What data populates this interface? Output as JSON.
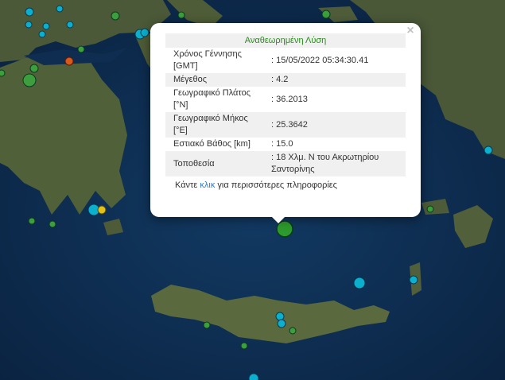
{
  "popup": {
    "title": "Αναθεωρημένη Λύση",
    "close_icon": "×",
    "rows": [
      {
        "label": "Χρόνος Γέννησης [GMT]",
        "value": ": 15/05/2022 05:34:30.41"
      },
      {
        "label": "Μέγεθος",
        "value": ": 4.2"
      },
      {
        "label": "Γεωγραφικό Πλάτος [°N]",
        "value": ": 36.2013"
      },
      {
        "label": "Γεωγραφικό Μήκος [°E]",
        "value": ": 25.3642"
      },
      {
        "label": "Εστιακό Βάθος [km]",
        "value": ": 15.0"
      },
      {
        "label": "Τοποθεσία",
        "value": ": 18 Χλμ. Ν του Ακρωτηρίου Σαντορίνης"
      }
    ],
    "more_prefix": "Κάντε ",
    "more_link": "κλικ",
    "more_suffix": " για περισσότερες πληροφορίες"
  },
  "colors": {
    "sea": "#0d2a4a",
    "land": "#4d5a3a",
    "event_recent": "#0bb0cf",
    "event_older": "#3c9e3c",
    "event_selected": "#2d9a2d",
    "event_hot": "#d85a1a"
  }
}
